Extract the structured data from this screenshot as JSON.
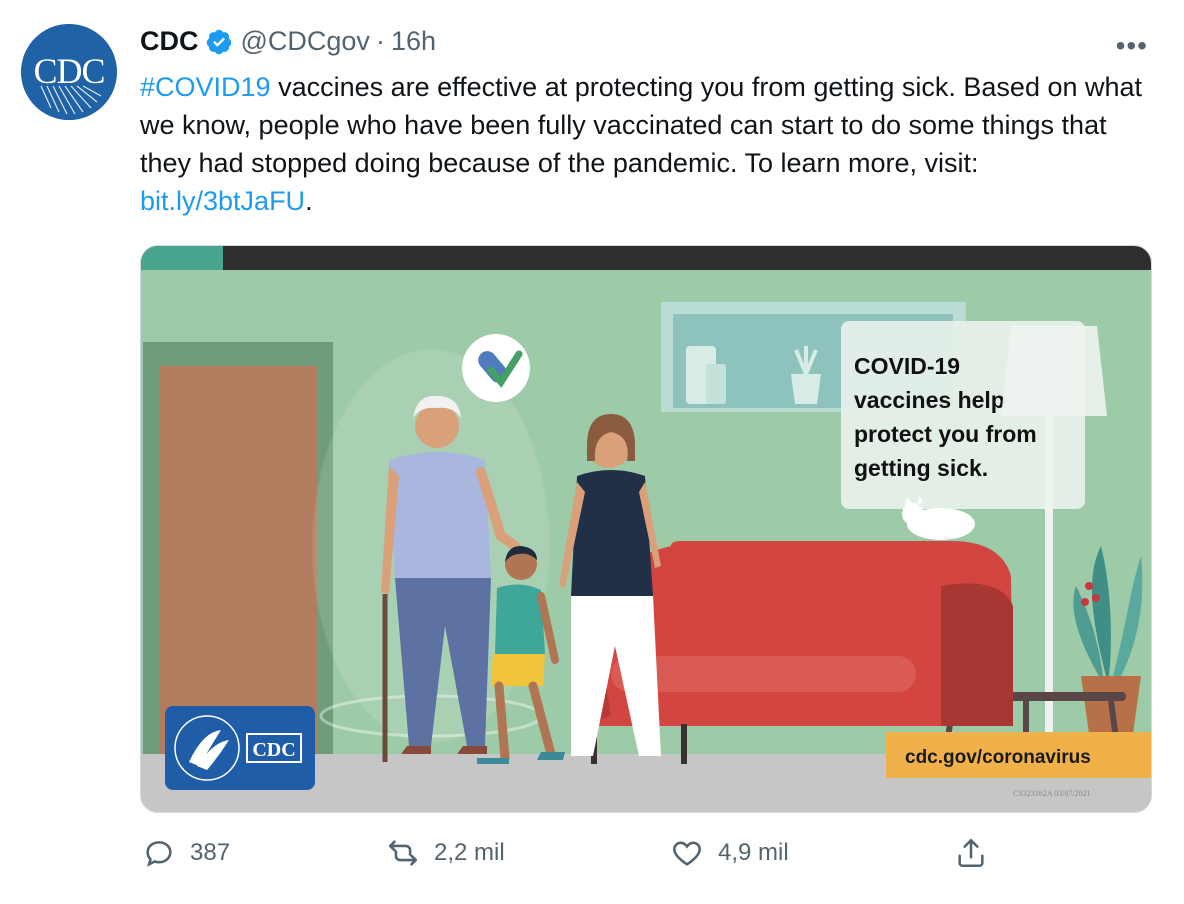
{
  "author": {
    "name": "CDC",
    "handle": "@CDCgov",
    "time": "16h",
    "avatar_text": "CDC"
  },
  "tweet": {
    "hashtag": "#COVID19",
    "text_part1": " vaccines are effective at protecting you from getting sick. Based on what we know, people who have been fully vaccinated can start to do some things that they had stopped doing because of the pandemic. To learn more, visit: ",
    "link": "bit.ly/3btJaFU",
    "text_part2": "."
  },
  "media": {
    "speech_line1": "COVID-19",
    "speech_line2": "vaccines help",
    "speech_line3": "protect you from",
    "speech_line4": "getting sick.",
    "url_banner": "cdc.gov/coronavirus",
    "logo_text": "CDC",
    "code": "CS323162A 03/07/2021"
  },
  "actions": {
    "replies": "387",
    "retweets": "2,2 mil",
    "likes": "4,9 mil"
  },
  "colors": {
    "link": "#1d9bf0",
    "wall": "#9dcaa7",
    "sofa": "#d34540",
    "banner": "#f0b14a"
  }
}
